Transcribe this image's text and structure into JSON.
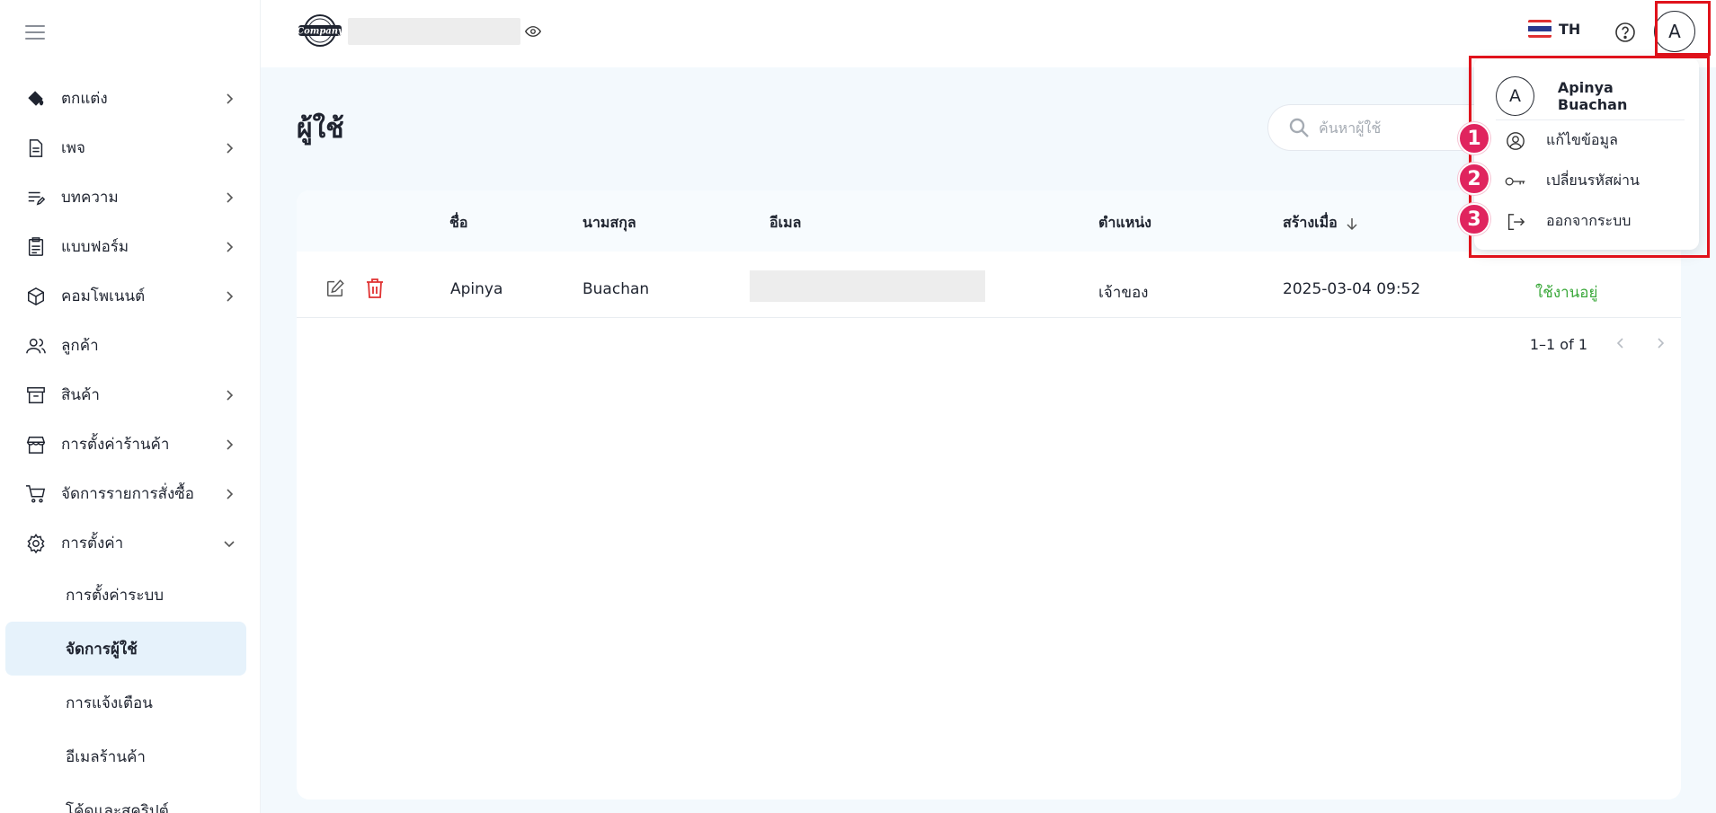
{
  "sidebar": {
    "items": [
      {
        "label": "ตกแต่ง",
        "icon": "paint-bucket-icon",
        "chevron": "right"
      },
      {
        "label": "เพจ",
        "icon": "document-icon",
        "chevron": "right"
      },
      {
        "label": "บทความ",
        "icon": "article-edit-icon",
        "chevron": "right"
      },
      {
        "label": "แบบฟอร์ม",
        "icon": "clipboard-icon",
        "chevron": "right"
      },
      {
        "label": "คอมโพเนนต์",
        "icon": "cube-icon",
        "chevron": "right"
      },
      {
        "label": "ลูกค้า",
        "icon": "users-icon",
        "chevron": ""
      },
      {
        "label": "สินค้า",
        "icon": "archive-box-icon",
        "chevron": "right"
      },
      {
        "label": "การตั้งค่าร้านค้า",
        "icon": "storefront-icon",
        "chevron": "right"
      },
      {
        "label": "จัดการรายการสั่งซื้อ",
        "icon": "cart-icon",
        "chevron": "right"
      },
      {
        "label": "การตั้งค่า",
        "icon": "gear-icon",
        "chevron": "down"
      }
    ],
    "subitems": [
      {
        "label": "การตั้งค่าระบบ",
        "active": false
      },
      {
        "label": "จัดการผู้ใช้",
        "active": true
      },
      {
        "label": "การแจ้งเตือน",
        "active": false
      },
      {
        "label": "อีเมลร้านค้า",
        "active": false
      },
      {
        "label": "โค้ดและสคริปต์",
        "active": false
      }
    ]
  },
  "topbar": {
    "logo_text": "Company",
    "language": "TH",
    "avatar_letter": "A"
  },
  "main": {
    "title": "ผู้ใช้",
    "search_placeholder": "ค้นหาผู้ใช้"
  },
  "table": {
    "columns": [
      "ชื่อ",
      "นามสกุล",
      "อีเมล",
      "ตำแหน่ง",
      "สร้างเมื่อ"
    ],
    "rows": [
      {
        "first_name": "Apinya",
        "last_name": "Buachan",
        "email": "",
        "role": "เจ้าของ",
        "created": "2025-03-04 09:52",
        "status": "ใช้งานอยู่"
      }
    ],
    "pagination": "1–1 of 1"
  },
  "user_menu": {
    "avatar_letter": "A",
    "name": "Apinya Buachan",
    "items": [
      {
        "label": "แก้ไขข้อมูล",
        "icon": "user-circle-icon",
        "badge": "1"
      },
      {
        "label": "เปลี่ยนรหัสผ่าน",
        "icon": "key-icon",
        "badge": "2"
      },
      {
        "label": "ออกจากระบบ",
        "icon": "logout-icon",
        "badge": "3"
      }
    ]
  },
  "colors": {
    "highlight": "#e0121b",
    "badge": "#e0245e",
    "status_active": "#3aa83a",
    "delete": "#e03131",
    "active_bg": "#e6f2fb"
  }
}
